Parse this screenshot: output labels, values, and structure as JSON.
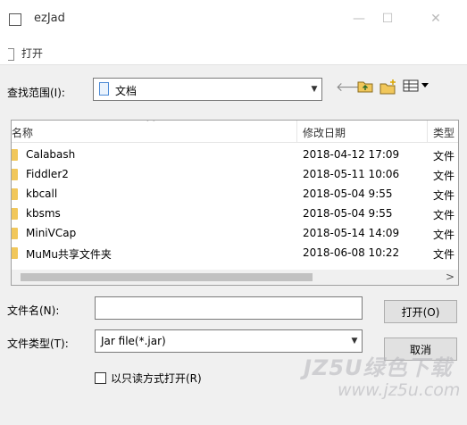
{
  "window": {
    "title": "ezJad"
  },
  "dialog": {
    "title": "打开",
    "look_in": {
      "label": "查找范围(I):",
      "value": "文档"
    },
    "columns": {
      "name": "名称",
      "modified": "修改日期",
      "type": "类型"
    },
    "files": [
      {
        "name": "Calabash",
        "modified": "2018-04-12 17:09",
        "type": "文件"
      },
      {
        "name": "Fiddler2",
        "modified": "2018-05-11 10:06",
        "type": "文件"
      },
      {
        "name": "kbcall",
        "modified": "2018-05-04 9:55",
        "type": "文件"
      },
      {
        "name": "kbsms",
        "modified": "2018-05-04 9:55",
        "type": "文件"
      },
      {
        "name": "MiniVCap",
        "modified": "2018-05-14 14:09",
        "type": "文件"
      },
      {
        "name": "MuMu共享文件夹",
        "modified": "2018-06-08 10:22",
        "type": "文件"
      }
    ],
    "file_name": {
      "label": "文件名(N):",
      "value": ""
    },
    "file_type": {
      "label": "文件类型(T):",
      "value": "Jar file(*.jar)"
    },
    "open_button": "打开(O)",
    "cancel_button": "取消",
    "readonly_label": "以只读方式打开(R)"
  },
  "watermark": {
    "main": "JZ5U绿色下载",
    "sub": "www.jz5u.com"
  },
  "colors": {
    "folder": "#f1c75b",
    "dialog_bg": "#f0f0f0"
  }
}
